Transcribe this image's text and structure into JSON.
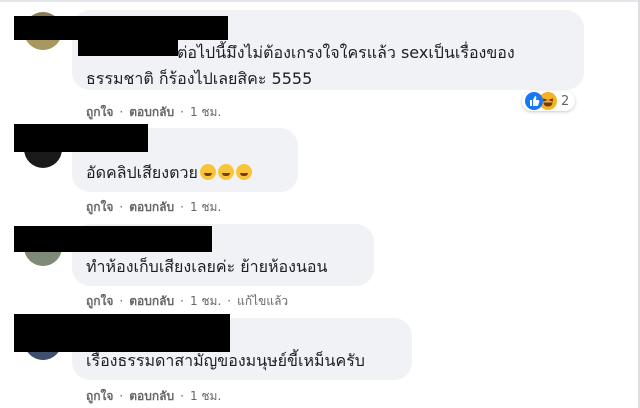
{
  "comments": [
    {
      "text_lines": [
        "ต่อไปนี้มึงไม่ต้องเกรงใจใครแล้ว sexเป็นเรื่องของ",
        "ธรรมชาติ ก็ร้องไปเลยสิคะ 5555"
      ],
      "like": "ถูกใจ",
      "reply": "ตอบกลับ",
      "time": "1 ชม.",
      "reaction_count": "2",
      "reaction_icons": [
        "like-icon",
        "haha-icon"
      ],
      "avatar_color": "#8a7a55"
    },
    {
      "text": "อัดคลิปเสียงตวย",
      "emoji_count": 3,
      "like": "ถูกใจ",
      "reply": "ตอบกลับ",
      "time": "1 ชม.",
      "avatar_color": "#1a1a1a"
    },
    {
      "text": "ทำห้องเก็บเสียงเลยค่ะ ย้ายห้องนอน",
      "like": "ถูกใจ",
      "reply": "ตอบกลับ",
      "time": "1 ชม.",
      "edited": "แก้ไขแล้ว",
      "avatar_color": "#9aa0a6"
    },
    {
      "text": "เรื่องธรรมดาสามัญของมนุษย์ขี้เหม็นครับ",
      "like": "ถูกใจ",
      "reply": "ตอบกลับ",
      "time": "1 ชม.",
      "avatar_color": "#5a6e8c"
    }
  ],
  "separator": "·"
}
